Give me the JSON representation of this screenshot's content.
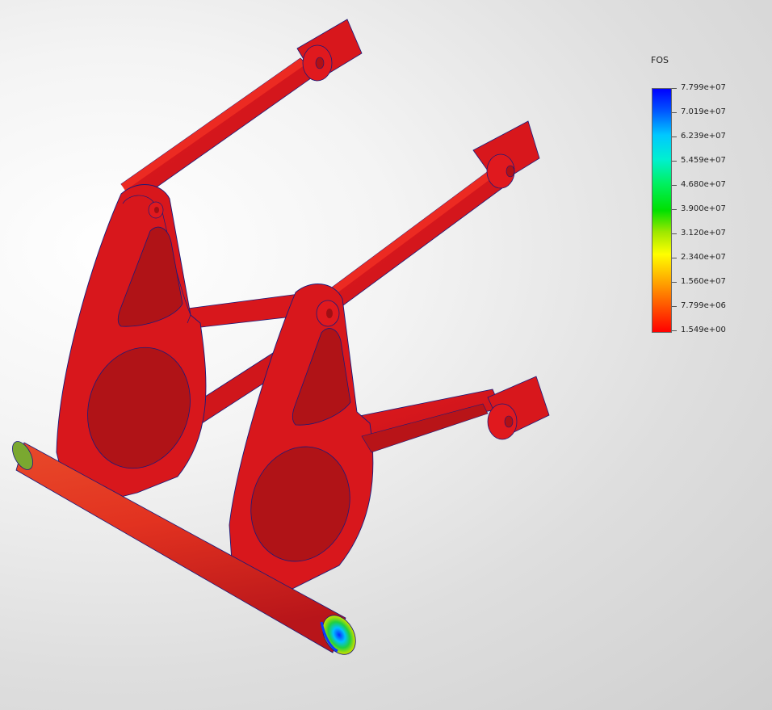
{
  "legend": {
    "title": "FOS",
    "ticks": [
      "7.799e+07",
      "7.019e+07",
      "6.239e+07",
      "5.459e+07",
      "4.680e+07",
      "3.900e+07",
      "3.120e+07",
      "2.340e+07",
      "1.560e+07",
      "7.799e+06",
      "1.549e+00"
    ],
    "colors": {
      "max": "#0000ff",
      "mid": "#00e000",
      "min": "#ff0000"
    }
  },
  "model": {
    "part_color": "#d8171c",
    "edge_color": "#1a1a7a"
  }
}
